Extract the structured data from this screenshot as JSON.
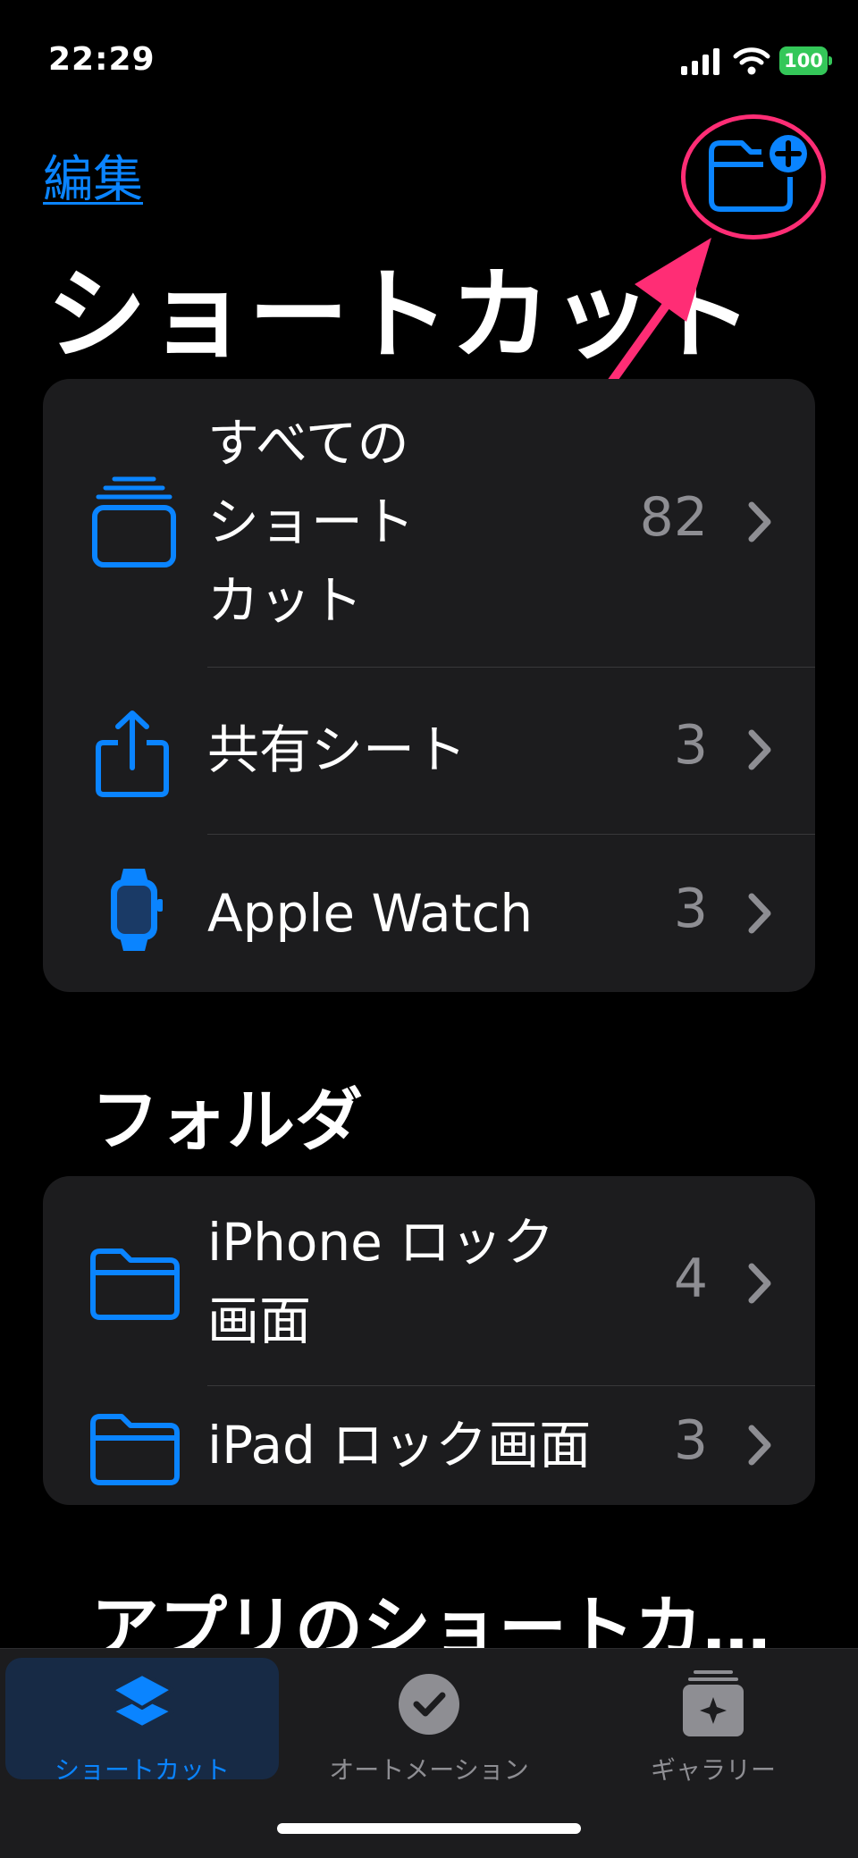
{
  "status_bar": {
    "time": "22:29",
    "battery": "100"
  },
  "nav": {
    "edit_label": "編集"
  },
  "page_title": "ショートカット",
  "top_list": {
    "items": [
      {
        "label_lines": [
          "すべての",
          "ショート",
          "カット"
        ],
        "count": "82"
      },
      {
        "label": "共有シート",
        "count": "3"
      },
      {
        "label": "Apple Watch",
        "count": "3"
      }
    ]
  },
  "folders": {
    "header": "フォルダ",
    "items": [
      {
        "label_lines": [
          "iPhone ロック",
          "画面"
        ],
        "count": "4"
      },
      {
        "label": "iPad ロック画面",
        "count": "3"
      }
    ]
  },
  "apps_header": "アプリのショートカ…",
  "tab_bar": {
    "tabs": [
      {
        "label": "ショートカット",
        "active": true
      },
      {
        "label": "オートメーション",
        "active": false
      },
      {
        "label": "ギャラリー",
        "active": false
      }
    ]
  },
  "colors": {
    "accent": "#0a84ff",
    "annotation": "#ff2d75",
    "card": "#1c1c1e",
    "secondary_text": "#8e8e93"
  }
}
